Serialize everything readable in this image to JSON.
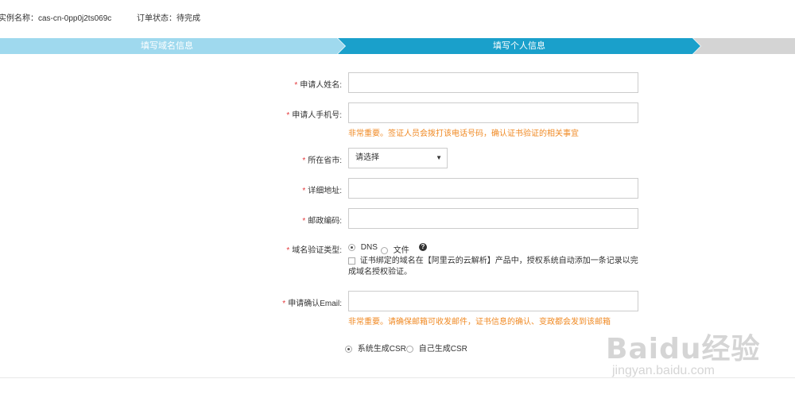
{
  "order": {
    "instance_label": "实例名称：cas-cn-0pp0j2ts069c",
    "status_label": "订单状态：待完成"
  },
  "steps": [
    {
      "label": "填写域名信息",
      "color": "#9fd9ee"
    },
    {
      "label": "填写个人信息",
      "color": "#1aa0cb"
    },
    {
      "label": "",
      "color": "#d4d4d4"
    }
  ],
  "form": {
    "required_mark": "*",
    "name_label": "申请人姓名:",
    "phone_label": "申请人手机号:",
    "phone_hint": "非常重要。签证人员会拨打该电话号码，确认证书验证的相关事宜",
    "province_label": "所在省市:",
    "province_select": "请选择",
    "address_label": "详细地址:",
    "postcode_label": "邮政编码:",
    "domain_verify_label": "域名验证类型:",
    "verify_options": [
      "DNS",
      "文件"
    ],
    "verify_selected": "DNS",
    "auto_dns_note": "证书绑定的域名在【阿里云的云解析】产品中，授权系统自动添加一条记录以完成域名授权验证。",
    "email_label": "申请确认Email:",
    "email_hint": "非常重要。请确保邮箱可收发邮件，证书信息的确认、变政都会发到该邮箱",
    "csr_options": [
      "系统生成CSR",
      "自己生成CSR"
    ],
    "csr_selected": "系统生成CSR"
  },
  "watermark": {
    "brand": "Baidu经验",
    "url": "jingyan.baidu.com"
  },
  "colors": {
    "required": "#e4393c",
    "hint": "#f08a24",
    "step_done": "#9fd9ee",
    "step_active": "#1aa0cb",
    "step_todo": "#d4d4d4"
  }
}
